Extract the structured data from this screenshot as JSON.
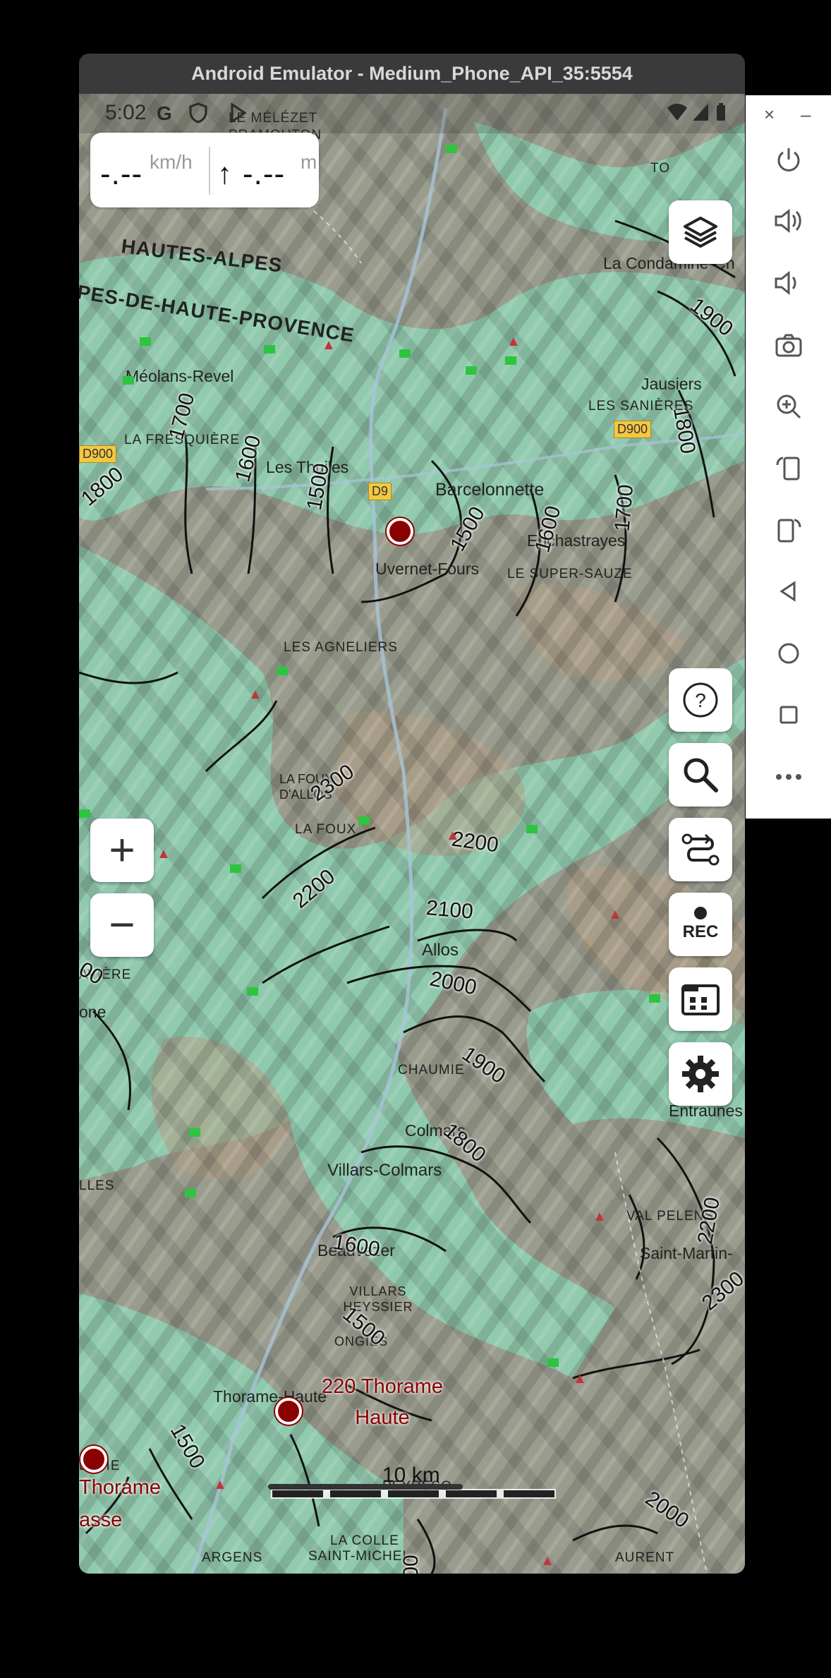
{
  "emulator": {
    "title": "Android Emulator - Medium_Phone_API_35:5554",
    "panel": {
      "close": "×",
      "minimize": "–"
    }
  },
  "status_bar": {
    "time": "5:02",
    "icons": [
      "google-g-icon",
      "shield-icon",
      "play-icon",
      "wifi-icon",
      "signal-icon",
      "battery-icon"
    ],
    "g": "G"
  },
  "speed_panel": {
    "speed_value": "-.--",
    "speed_unit": "km/h",
    "altitude_arrow": "↑",
    "altitude_value": "-.--",
    "altitude_unit": "m"
  },
  "map_labels": {
    "places": [
      "LE MÉLÉZET",
      "PRAMOUTON",
      "HAUTES-ALPES",
      "PES-DE-HAUTE-PROVENCE",
      "Méolans-Revel",
      "LA FRESQUIÈRE",
      "Les Thuiles",
      "Barcelonnette",
      "Enchastrayes",
      "Uvernet-Fours",
      "LE SUPER-SAUZE",
      "LES AGNELIERS",
      "LA FOUX D'ALLOS",
      "LA FOUX",
      "Allos",
      "CHAUMIE",
      "Colmars",
      "Villars-Colmars",
      "Beauvezer",
      "VILLARS HEYSSIER",
      "ONGIES",
      "Thorame-Haute",
      "VAL PELENS",
      "Saint-Martin-",
      "Entraunes",
      "La Condamine-Ch",
      "Jausiers",
      "LES SANIÈRES",
      "AVIÈRE",
      "one",
      "LLES",
      "ARGENS",
      "LA COLLE",
      "SAINT-MICHEL",
      "PEYRESQ",
      "AURENT",
      "BATIE",
      "TO"
    ],
    "roads": [
      "D900",
      "D900",
      "D900",
      "D9"
    ],
    "contours": [
      "2000",
      "1900",
      "1800",
      "1700",
      "1600",
      "1500",
      "1500",
      "1600",
      "1700",
      "1800",
      "2300",
      "2200",
      "2200",
      "2100",
      "2000",
      "1900",
      "1800",
      "1600",
      "1500",
      "1500",
      "2200",
      "2300",
      "2000",
      "00",
      "00"
    ],
    "stations": [
      {
        "name": "220 Thorame\nHaute"
      },
      {
        "name": "Thorame\nasse"
      }
    ]
  },
  "map_buttons": {
    "layers": "layers-icon",
    "help": "help-icon",
    "search": "search-icon",
    "route": "route-icon",
    "rec_label": "REC",
    "offline": "offline-maps-icon",
    "settings": "gear-icon",
    "zoom_in": "+",
    "zoom_out": "−"
  },
  "scale": {
    "label": "10 km"
  },
  "colors": {
    "terrain_green": "#8fd2b4",
    "terrain_brown": "#a8957c",
    "marker_red": "#8b0000",
    "title_bar": "#3a3a3a"
  }
}
